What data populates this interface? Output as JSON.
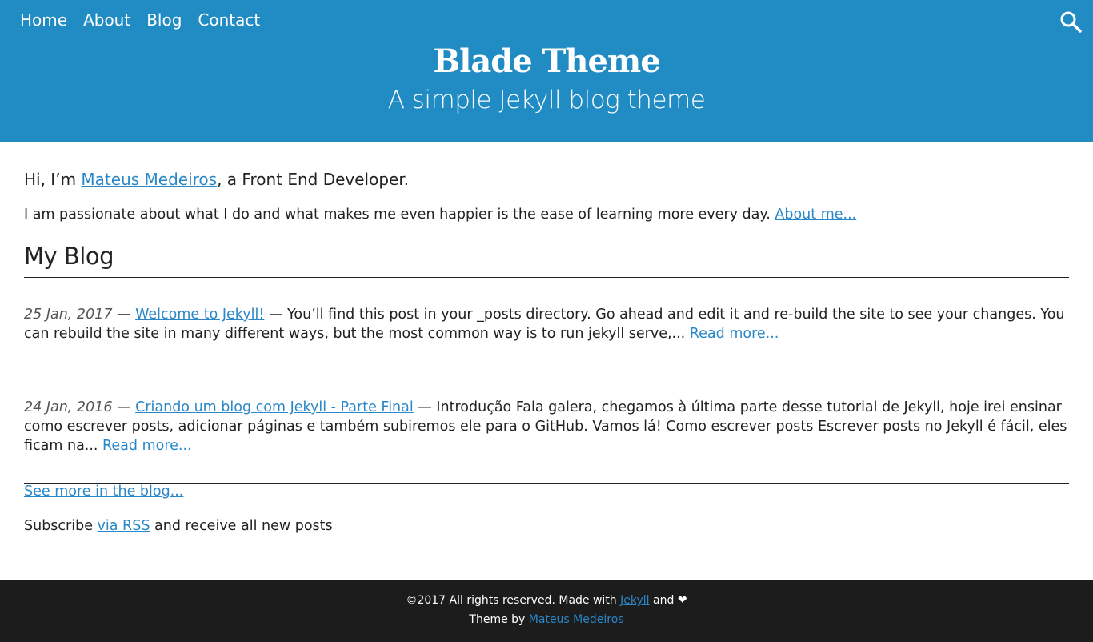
{
  "nav": {
    "items": [
      "Home",
      "About",
      "Blog",
      "Contact"
    ]
  },
  "header": {
    "title": "Blade Theme",
    "tagline": "A simple Jekyll blog theme"
  },
  "intro": {
    "prefix": "Hi, I’m ",
    "name": "Mateus Medeiros",
    "suffix": ", a Front End Developer."
  },
  "about": {
    "text": "I am passionate about what I do and what makes me even happier is the ease of learning more every day. ",
    "link": "About me..."
  },
  "blog": {
    "heading": "My Blog",
    "separator": " — ",
    "read_more": "Read more...",
    "posts": [
      {
        "date": "25 Jan, 2017",
        "title": "Welcome to Jekyll!",
        "excerpt": "You’ll find this post in your _posts directory. Go ahead and edit it and re-build the site to see your changes. You can rebuild the site in many different ways, but the most common way is to run jekyll serve,... "
      },
      {
        "date": "24 Jan, 2016",
        "title": "Criando um blog com Jekyll - Parte Final",
        "excerpt": "Introdução Fala galera, chegamos à última parte desse tutorial de Jekyll, hoje irei ensinar como escrever posts, adicionar páginas e também subiremos ele para o GitHub. Vamos lá! Como escrever posts Escrever posts no Jekyll é fácil, eles ficam na... "
      }
    ],
    "see_more": "See more in the blog..."
  },
  "subscribe": {
    "prefix": "Subscribe ",
    "link": "via RSS",
    "suffix": " and receive all new posts"
  },
  "footer": {
    "line1_prefix": "©2017 All rights reserved. Made with ",
    "line1_link": "Jekyll",
    "line1_suffix": " and ",
    "line2_prefix": "Theme by ",
    "line2_link": "Mateus Medeiros"
  }
}
